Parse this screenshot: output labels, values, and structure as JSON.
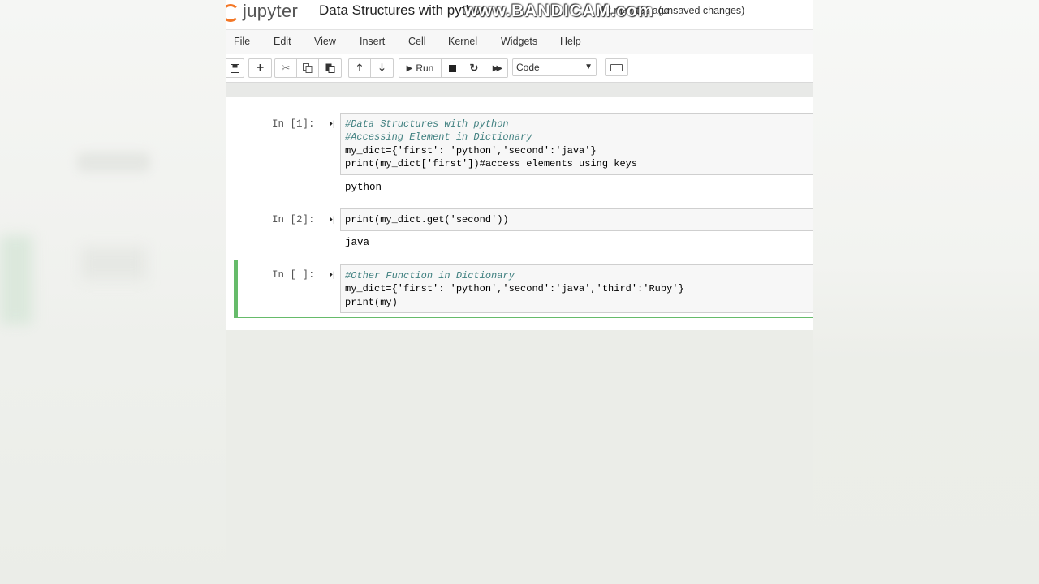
{
  "header": {
    "logo_text": "jupyter",
    "notebook_title": "Data Structures with python",
    "last_saved": "12 minutes ago",
    "unsaved": "(unsaved changes)",
    "watermark": "www.BANDICAM.com"
  },
  "menu": [
    "File",
    "Edit",
    "View",
    "Insert",
    "Cell",
    "Kernel",
    "Widgets",
    "Help"
  ],
  "toolbar": {
    "run_label": "Run",
    "cell_type": "Code",
    "icons": [
      "save-icon",
      "plus-icon",
      "cut-icon",
      "copy-icon",
      "paste-icon",
      "arrow-up-icon",
      "arrow-down-icon",
      "run-icon",
      "stop-icon",
      "restart-icon",
      "fast-forward-icon",
      "keyboard-icon"
    ]
  },
  "cells": [
    {
      "prompt": "In [1]:",
      "lines": [
        "#Data Structures with python",
        "#Accessing Element in Dictionary",
        "my_dict={'first': 'python','second':'java'}",
        "print(my_dict['first'])#access elements using keys"
      ],
      "output": "python"
    },
    {
      "prompt": "In [2]:",
      "lines": [
        "print(my_dict.get('second'))"
      ],
      "output": "java"
    },
    {
      "prompt": "In [ ]:",
      "lines": [
        "#Other Function in Dictionary",
        "my_dict={'first': 'python','second':'java','third':'Ruby'}",
        "print(my)"
      ]
    }
  ],
  "colors": {
    "accent": "#f37726",
    "selected": "#66bb6a",
    "comment": "#408080",
    "string": "#ba2121",
    "builtin": "#008000"
  }
}
